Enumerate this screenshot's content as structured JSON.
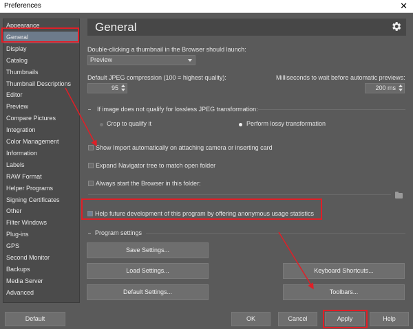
{
  "window": {
    "title": "Preferences",
    "close_glyph": "✕"
  },
  "sidebar": {
    "items": [
      {
        "label": "Appearance"
      },
      {
        "label": "General"
      },
      {
        "label": "Display"
      },
      {
        "label": "Catalog"
      },
      {
        "label": "Thumbnails"
      },
      {
        "label": "Thumbnail Descriptions"
      },
      {
        "label": "Editor"
      },
      {
        "label": "Preview"
      },
      {
        "label": "Compare Pictures"
      },
      {
        "label": "Integration"
      },
      {
        "label": "Color Management"
      },
      {
        "label": "Information"
      },
      {
        "label": "Labels"
      },
      {
        "label": "RAW Format"
      },
      {
        "label": "Helper Programs"
      },
      {
        "label": "Signing Certificates"
      },
      {
        "label": "Other"
      },
      {
        "label": "Filter Windows"
      },
      {
        "label": "Plug-ins"
      },
      {
        "label": "GPS"
      },
      {
        "label": "Second Monitor"
      },
      {
        "label": "Backups"
      },
      {
        "label": "Media Server"
      },
      {
        "label": "Advanced"
      }
    ],
    "selected": "General"
  },
  "page": {
    "title": "General",
    "gear_icon": "gear-icon",
    "launch_label": "Double-clicking a thumbnail in the Browser should launch:",
    "launch_value": "Preview",
    "jpeg_label": "Default JPEG compression (100 = highest quality):",
    "jpeg_value": "95",
    "ms_label": "Milliseconds to wait before automatic previews:",
    "ms_value": "200 ms",
    "lossless_label": "If image does not qualify for lossless JPEG transformation:",
    "radio_crop": "Crop to qualify it",
    "radio_lossy": "Perform lossy transformation",
    "radio_selected": "Perform lossy transformation",
    "chk_import": "Show Import automatically on attaching camera or inserting card",
    "chk_expand": "Expand Navigator tree to match open folder",
    "chk_start": "Always start the Browser in this folder:",
    "chk_help": "Help future development of this program by offering anonymous usage statistics",
    "program_settings": "Program settings",
    "buttons": {
      "save": "Save Settings...",
      "load": "Load Settings...",
      "default_settings": "Default Settings...",
      "keyboard": "Keyboard Shortcuts...",
      "toolbars": "Toolbars..."
    }
  },
  "footer": {
    "default": "Default",
    "ok": "OK",
    "cancel": "Cancel",
    "apply": "Apply",
    "help": "Help"
  },
  "annotation_color": "#e01f27"
}
